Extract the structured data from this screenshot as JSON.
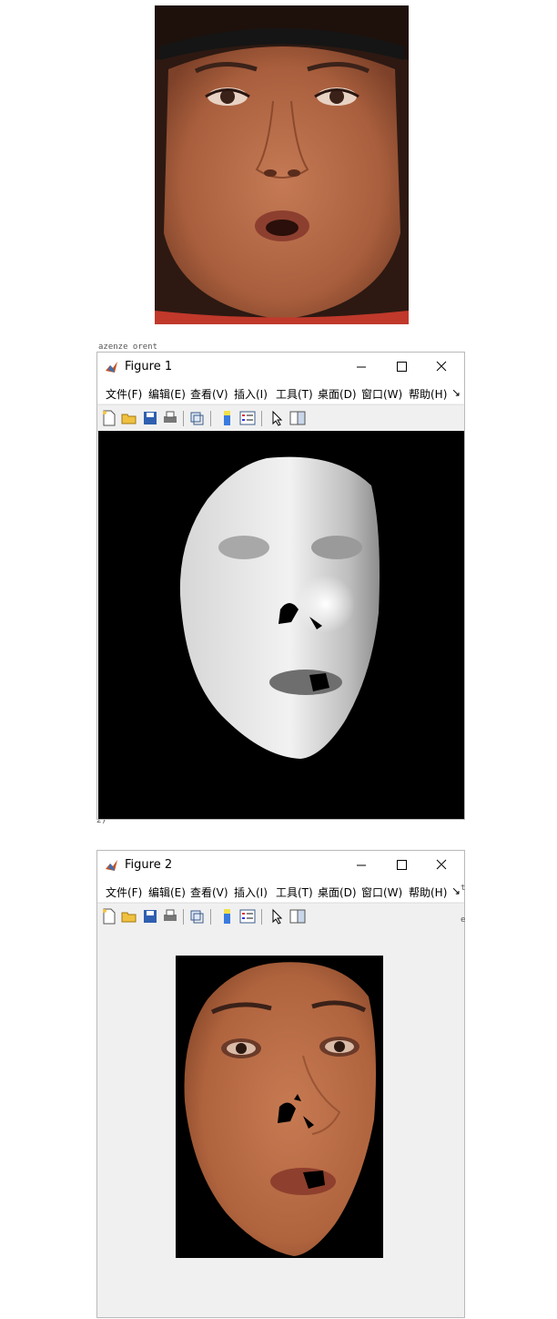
{
  "background_fragments": {
    "code_top": "azenze orent",
    "code_side_1": "2)",
    "code_side_2": "t",
    "code_side_3": "e"
  },
  "figure1": {
    "title": "Figure 1",
    "menu": [
      "文件(F)",
      "编辑(E)",
      "查看(V)",
      "插入(I)",
      "工具(T)",
      "桌面(D)",
      "窗口(W)",
      "帮助(H)"
    ],
    "menu_overflow": "↘",
    "image": "depth-map-face-grayscale"
  },
  "figure2": {
    "title": "Figure 2",
    "menu": [
      "文件(F)",
      "编辑(E)",
      "查看(V)",
      "插入(I)",
      "工具(T)",
      "桌面(D)",
      "窗口(W)",
      "帮助(H)"
    ],
    "menu_overflow": "↘",
    "image": "masked-face-texture"
  },
  "toolbar_icons": [
    "new-figure-icon",
    "open-icon",
    "save-icon",
    "print-icon",
    "link-plot-icon",
    "colorbar-icon",
    "legend-icon",
    "pointer-icon",
    "property-editor-icon"
  ],
  "colors": {
    "window_bg": "#f0f0f0",
    "titlebar_bg": "#ffffff",
    "skin": "#b5653e",
    "hair": "#2a1a14"
  }
}
